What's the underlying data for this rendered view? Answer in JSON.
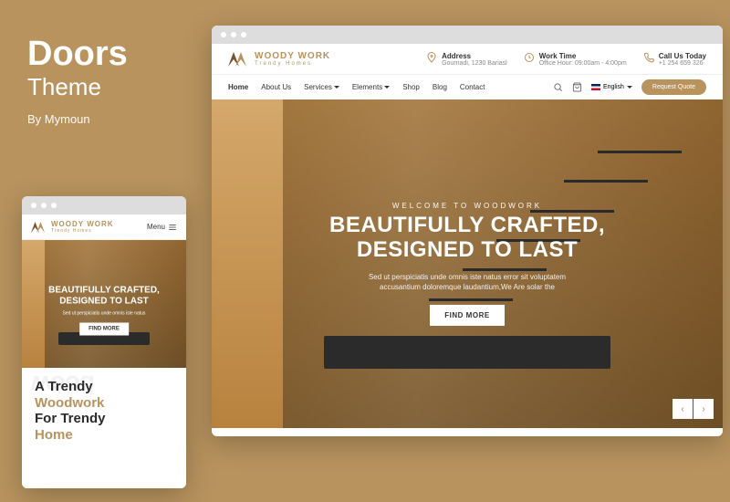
{
  "sidebar": {
    "title": "Doors",
    "subtitle": "Theme",
    "author": "By Mymoun"
  },
  "logo": {
    "name": "WOODY WORK",
    "tagline": "Trendy Homes"
  },
  "contacts": {
    "address": {
      "label": "Address",
      "value": "Gournadi, 1230 Bariasl"
    },
    "worktime": {
      "label": "Work Time",
      "value": "Office Hour: 09:00am - 4:00pm"
    },
    "call": {
      "label": "Call Us Today",
      "value": "+1 254 659 326"
    }
  },
  "nav": {
    "items": [
      "Home",
      "About Us",
      "Services",
      "Elements",
      "Shop",
      "Blog",
      "Contact"
    ],
    "language": "English",
    "quote_label": "Request Quote"
  },
  "hero": {
    "eyebrow": "WELCOME TO WOODWORK",
    "title_line1": "BEAUTIFULLY CRAFTED,",
    "title_line2": "DESIGNED TO LAST",
    "desc_line1": "Sed ut perspiciatis unde omnis iste natus error sit voluptatem",
    "desc_line2": "accusantium doloremque laudantium,We Are solar the",
    "cta": "FIND MORE"
  },
  "mobile": {
    "menu_label": "Menu",
    "hero_title_line1": "BEAUTIFULLY CRAFTED,",
    "hero_title_line2": "DESIGNED TO LAST",
    "hero_desc": "Sed ut perspiciatis unde omnis iste natus",
    "hero_cta": "FIND MORE",
    "watermark": "wood",
    "section_title_1": "A Trendy",
    "section_title_2": "Woodwork",
    "section_title_3": "For Trendy",
    "section_title_4": "Home"
  }
}
